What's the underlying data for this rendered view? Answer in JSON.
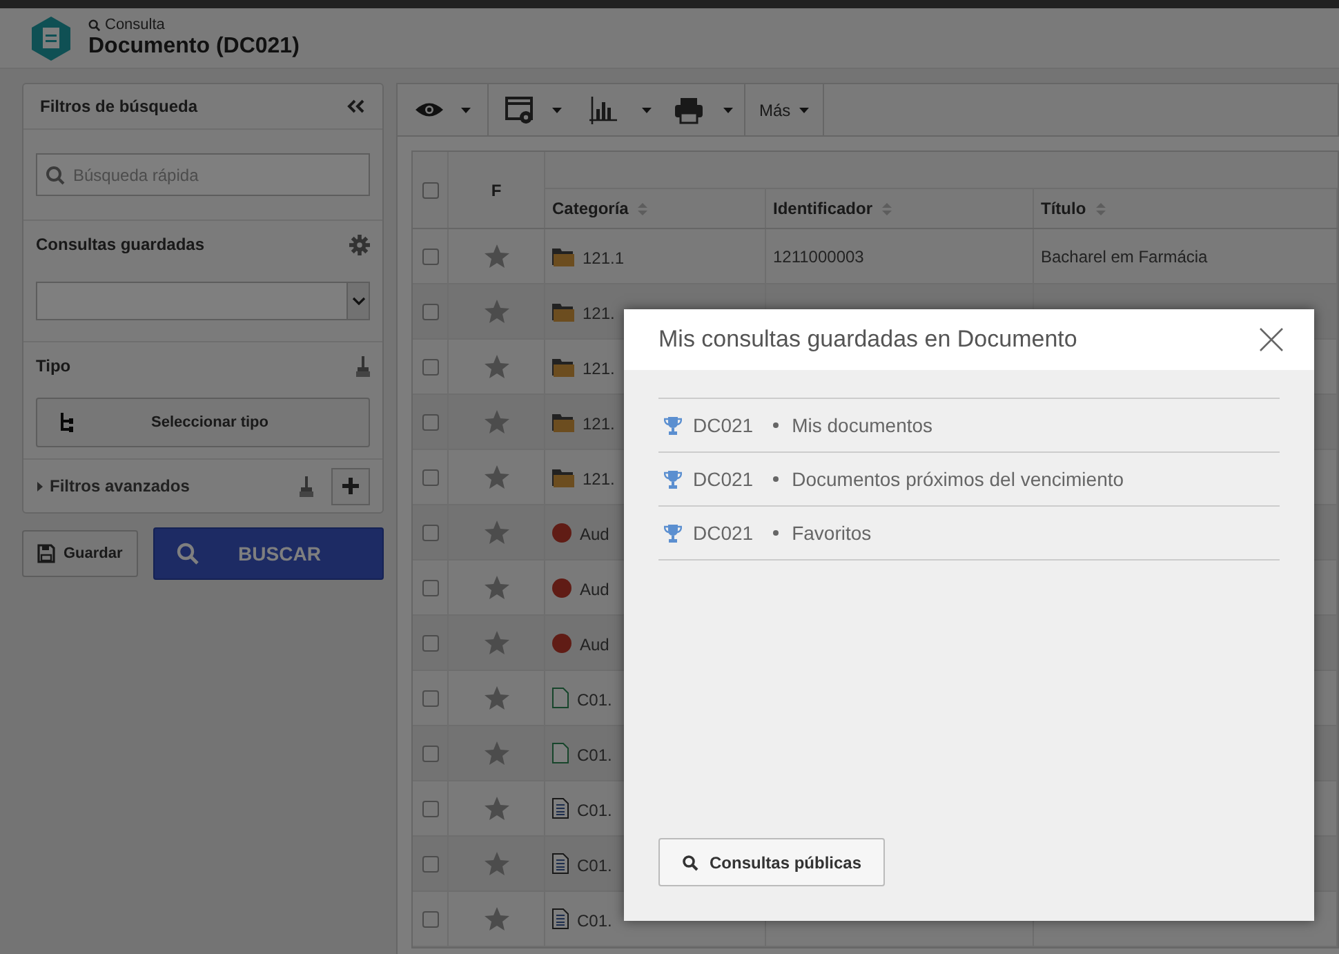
{
  "header": {
    "breadcrumb": "Consulta",
    "title": "Documento (DC021)"
  },
  "sidebar": {
    "title": "Filtros de búsqueda",
    "search_placeholder": "Búsqueda rápida",
    "saved_queries_label": "Consultas guardadas",
    "type_label": "Tipo",
    "select_type_button": "Seleccionar tipo",
    "advanced_filters": {
      "label": "Filtros avanzados",
      "expanded": false
    },
    "save_button": "Guardar",
    "search_button": "BUSCAR"
  },
  "toolbar": {
    "more_menu": "Más"
  },
  "table": {
    "select_all_checked": false,
    "columns": [
      "F",
      "Categoría",
      "Identificador",
      "Título"
    ],
    "rows": [
      {
        "kind": "folder",
        "checked": false,
        "category": "121.1",
        "identifier": "1211000003",
        "title": "Bacharel em Farmácia"
      },
      {
        "kind": "folder",
        "checked": false,
        "category": "121."
      },
      {
        "kind": "folder",
        "checked": false,
        "category": "121."
      },
      {
        "kind": "folder",
        "checked": false,
        "category": "121."
      },
      {
        "kind": "folder",
        "checked": false,
        "category": "121."
      },
      {
        "kind": "audit",
        "checked": false,
        "category": "Aud"
      },
      {
        "kind": "audit",
        "checked": false,
        "category": "Aud"
      },
      {
        "kind": "audit",
        "checked": false,
        "category": "Aud"
      },
      {
        "kind": "file",
        "checked": false,
        "category": "C01."
      },
      {
        "kind": "file",
        "checked": false,
        "category": "C01."
      },
      {
        "kind": "doc",
        "checked": false,
        "category": "C01."
      },
      {
        "kind": "doc",
        "checked": false,
        "category": "C01."
      },
      {
        "kind": "doc",
        "checked": false,
        "category": "C01."
      }
    ]
  },
  "modal": {
    "title": "Mis consultas guardadas en Documento",
    "items": [
      {
        "code": "DC021",
        "name": "Mis documentos"
      },
      {
        "code": "DC021",
        "name": "Documentos próximos del vencimiento"
      },
      {
        "code": "DC021",
        "name": "Favoritos"
      }
    ],
    "public_button": "Consultas públicas"
  }
}
